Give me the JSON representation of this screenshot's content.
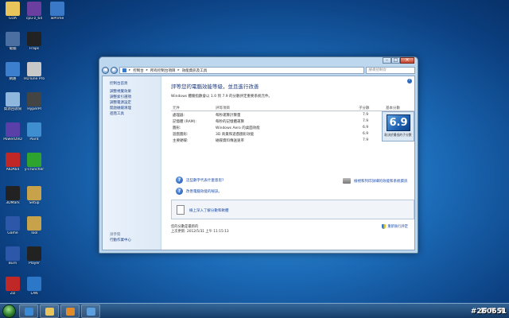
{
  "desktop": {
    "icons": [
      {
        "label": "GOA",
        "icon": "folder-icon",
        "color": "#e8c45a"
      },
      {
        "label": "cpu-z_64",
        "icon": "cpuz-icon",
        "color": "#6a3fa0"
      },
      {
        "label": "wPrime",
        "icon": "wprime-icon",
        "color": "#3a78c8"
      },
      {
        "label": "電腦",
        "icon": "computer-icon",
        "color": "#4a6fa0"
      },
      {
        "label": "Fraps",
        "icon": "fraps-icon",
        "color": "#222222"
      },
      {
        "label": "網路",
        "icon": "network-icon",
        "color": "#3c7fcf"
      },
      {
        "label": "HDTune Pro",
        "icon": "hdtune-icon",
        "color": "#c8c8c8"
      },
      {
        "label": "資源回收筒",
        "icon": "recycle-bin-icon",
        "color": "#8fb6dd"
      },
      {
        "label": "HyperPI",
        "icon": "hyperpi-icon",
        "color": "#444444"
      },
      {
        "label": "PowerDVD",
        "icon": "powerdvd-icon",
        "color": "#5a3fa8"
      },
      {
        "label": "Paint",
        "icon": "paint-icon",
        "color": "#3f8fd0"
      },
      {
        "label": "AIDA64",
        "icon": "aida64-icon",
        "color": "#c02828"
      },
      {
        "label": "y-cruncher",
        "icon": "ycruncher-icon",
        "color": "#2ea42e"
      },
      {
        "label": "3DMark",
        "icon": "3dmark-icon",
        "color": "#222222"
      },
      {
        "label": "Setup",
        "icon": "setup-icon",
        "color": "#c8a24a"
      },
      {
        "label": "Game",
        "icon": "game-icon",
        "color": "#2d57a8"
      },
      {
        "label": "Tool",
        "icon": "tool-icon",
        "color": "#c8a24a"
      },
      {
        "label": "Burn",
        "icon": "burn-icon",
        "color": "#2d57a8"
      },
      {
        "label": "Player",
        "icon": "player-icon",
        "color": "#222222"
      },
      {
        "label": "ZD",
        "icon": "zd-icon",
        "color": "#c02828"
      },
      {
        "label": "LAN",
        "icon": "lan-icon",
        "color": "#2d77c8"
      }
    ]
  },
  "window": {
    "breadcrumb": [
      "控制台",
      "所有控制台項目",
      "效能資訊及工具"
    ],
    "search_placeholder": "搜尋控制台",
    "left_nav": {
      "home": "控制台首頁",
      "items": [
        "調整視覺效果",
        "調整索引選項",
        "調整電源設定",
        "開啟磁碟清理",
        "進階工具"
      ],
      "see_also_heading": "請參閱",
      "see_also": [
        "行動作業中心"
      ]
    },
    "title": "評等您的電腦效能等級，並且進行改善",
    "subtitle": "Windows 體驗指數會以 1.0 到 7.9 的分數評定重要系統元件。",
    "table": {
      "headers": [
        "元件",
        "評等項目",
        "子分數",
        "基本分數"
      ],
      "rows": [
        {
          "component": "處理器:",
          "rating": "每秒運算計算量",
          "score": "7.9"
        },
        {
          "component": "記憶體 (RAM):",
          "rating": "每秒的記憶體運算",
          "score": "7.9"
        },
        {
          "component": "圖形:",
          "rating": "Windows Aero 的桌面效能",
          "score": "6.9"
        },
        {
          "component": "遊戲圖形:",
          "rating": "3D 商業和遊戲圖形效能",
          "score": "6.9"
        },
        {
          "component": "主要硬碟:",
          "rating": "磁碟資料傳送速率",
          "score": "7.9"
        }
      ],
      "base_score": "6.9",
      "base_caption": "取決於最低的子分數"
    },
    "links": {
      "what_mean": "這些數字代表什麼意思?",
      "improve": "改善電腦效能的秘訣。",
      "print": "檢視和列印詳細的效能和系統資訊"
    },
    "rerun_note": "線上深入了解分數和軟體",
    "footer": {
      "line1": "您的分數是最新的",
      "line2": "上次更新: 2012/5/31 上午 11:15:13",
      "rerun_label": "重新執行評定"
    }
  },
  "watermark": "#260651"
}
